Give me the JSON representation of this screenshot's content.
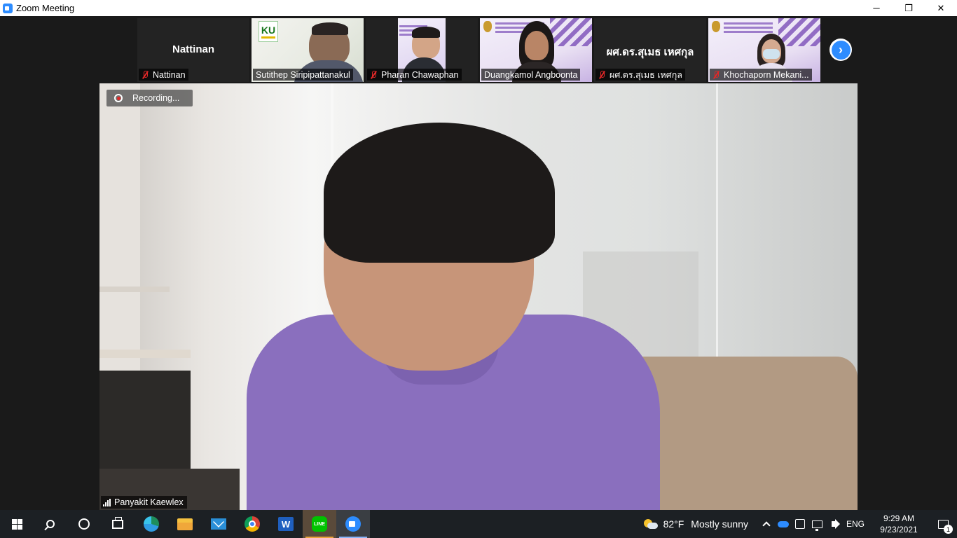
{
  "window": {
    "title": "Zoom Meeting",
    "minimize": "─",
    "restore": "❐",
    "close": "✕"
  },
  "gallery": {
    "tiles": [
      {
        "name": "Nattinan",
        "display_name": "Nattinan",
        "muted": true,
        "video": false
      },
      {
        "name": "Sutithep Siripipattanakul",
        "muted": false,
        "video": true
      },
      {
        "name": "Pharan Chawaphan",
        "muted": true,
        "video": true
      },
      {
        "name": "Duangkamol Angboonta",
        "muted": false,
        "video": true
      },
      {
        "name": "ผศ.ดร.สุเมธ เหศกุล",
        "display_name": "ผศ.ดร.สุเมธ เหศกุล",
        "muted": true,
        "video": false
      },
      {
        "name": "Khochaporn Mekani...",
        "muted": true,
        "video": true
      }
    ],
    "ku_logo_text": "KU",
    "next_arrow": "›"
  },
  "active_speaker": {
    "name": "Panyakit Kaewlex",
    "recording_label": "Recording..."
  },
  "taskbar": {
    "apps": [
      "start",
      "search",
      "cortana",
      "task-view",
      "edge",
      "file-explorer",
      "mail",
      "chrome",
      "word",
      "line",
      "zoom"
    ],
    "word_letter": "W",
    "line_text": "LINE",
    "weather": {
      "temp": "82°F",
      "condition": "Mostly sunny"
    },
    "language": "ENG",
    "time": "9:29 AM",
    "date": "9/23/2021",
    "notification_count": "1"
  },
  "colors": {
    "zoom_blue": "#2d8cff",
    "muted_red": "#e02828",
    "taskbar": "#1c2024"
  }
}
